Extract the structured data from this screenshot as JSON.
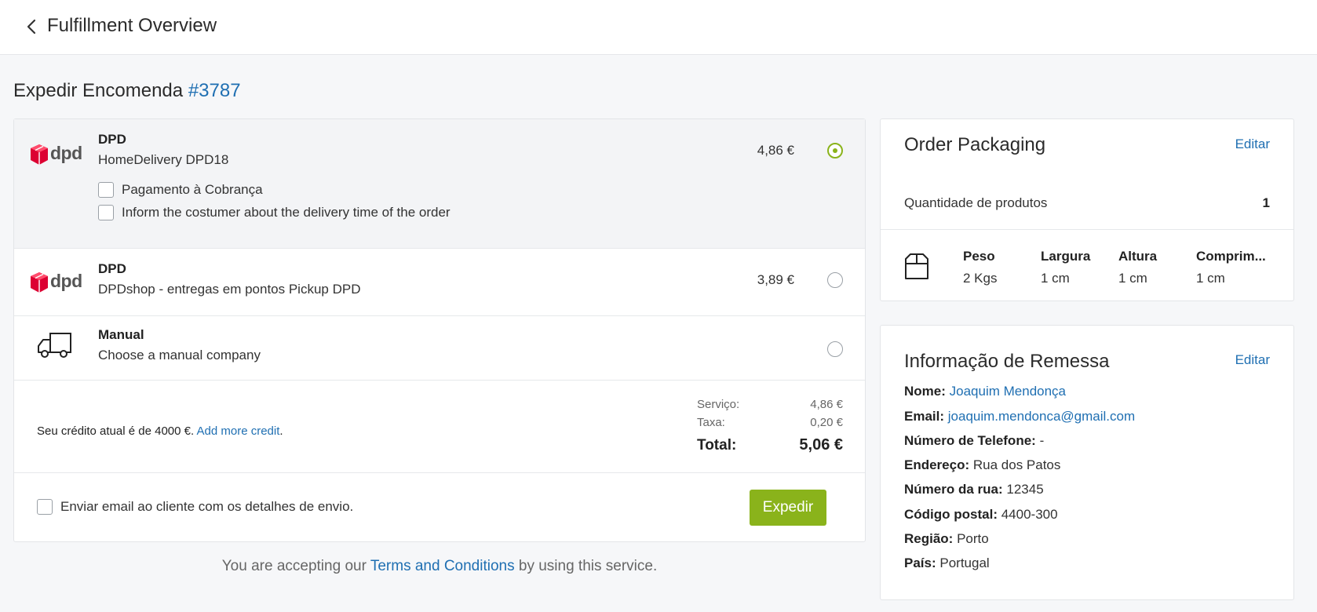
{
  "header": {
    "title": "Fulfillment Overview"
  },
  "page": {
    "title_prefix": "Expedir Encomenda",
    "order_number": "#3787"
  },
  "carriers": [
    {
      "logo": "dpd-logo",
      "logo_text": "dpd",
      "name": "DPD",
      "service": "HomeDelivery DPD18",
      "price": "4,86 €",
      "selected": true,
      "options": [
        {
          "label": "Pagamento à Cobrança",
          "checked": false
        },
        {
          "label": "Inform the costumer about the delivery time of the order",
          "checked": false
        }
      ]
    },
    {
      "logo": "dpd-logo",
      "logo_text": "dpd",
      "name": "DPD",
      "service": "DPDshop - entregas em pontos Pickup DPD",
      "price": "3,89 €",
      "selected": false
    },
    {
      "logo": "truck-icon",
      "name": "Manual",
      "service": "Choose a manual company",
      "price": "",
      "selected": false
    }
  ],
  "summary": {
    "credit_text": "Seu crédito atual é de 4000 €.",
    "add_credit_link": "Add more credit",
    "credit_suffix": ".",
    "service_label": "Serviço:",
    "service_value": "4,86 €",
    "tax_label": "Taxa:",
    "tax_value": "0,20 €",
    "total_label": "Total:",
    "total_value": "5,06 €"
  },
  "footer": {
    "email_label": "Enviar email ao cliente com os detalhes de envio.",
    "email_checked": false,
    "ship_button": "Expedir"
  },
  "terms": {
    "prefix": "You are accepting our",
    "link": "Terms and Conditions",
    "suffix": "by using this service."
  },
  "packaging": {
    "title": "Order Packaging",
    "edit": "Editar",
    "quantity_label": "Quantidade de produtos",
    "quantity_value": "1",
    "icon": "box-icon",
    "dimensions": [
      {
        "label": "Peso",
        "value": "2 Kgs"
      },
      {
        "label": "Largura",
        "value": "1 cm"
      },
      {
        "label": "Altura",
        "value": "1 cm"
      },
      {
        "label": "Comprim...",
        "value": "1 cm"
      }
    ]
  },
  "shipment": {
    "title": "Informação de Remessa",
    "edit": "Editar",
    "fields": [
      {
        "label": "Nome:",
        "value": "Joaquim Mendonça",
        "link": true
      },
      {
        "label": "Email:",
        "value": "joaquim.mendonca@gmail.com",
        "link": true
      },
      {
        "label": "Número de Telefone:",
        "value": "-",
        "link": false
      },
      {
        "label": "Endereço:",
        "value": "Rua dos Patos",
        "link": false
      },
      {
        "label": "Número da rua:",
        "value": "12345",
        "link": false
      },
      {
        "label": "Código postal:",
        "value": "4400-300",
        "link": false
      },
      {
        "label": "Região:",
        "value": "Porto",
        "link": false
      },
      {
        "label": "País:",
        "value": "Portugal",
        "link": false
      }
    ]
  },
  "colors": {
    "accent_green": "#8ab31b",
    "link_blue": "#1f6fb2",
    "dpd_red": "#dc0032"
  }
}
